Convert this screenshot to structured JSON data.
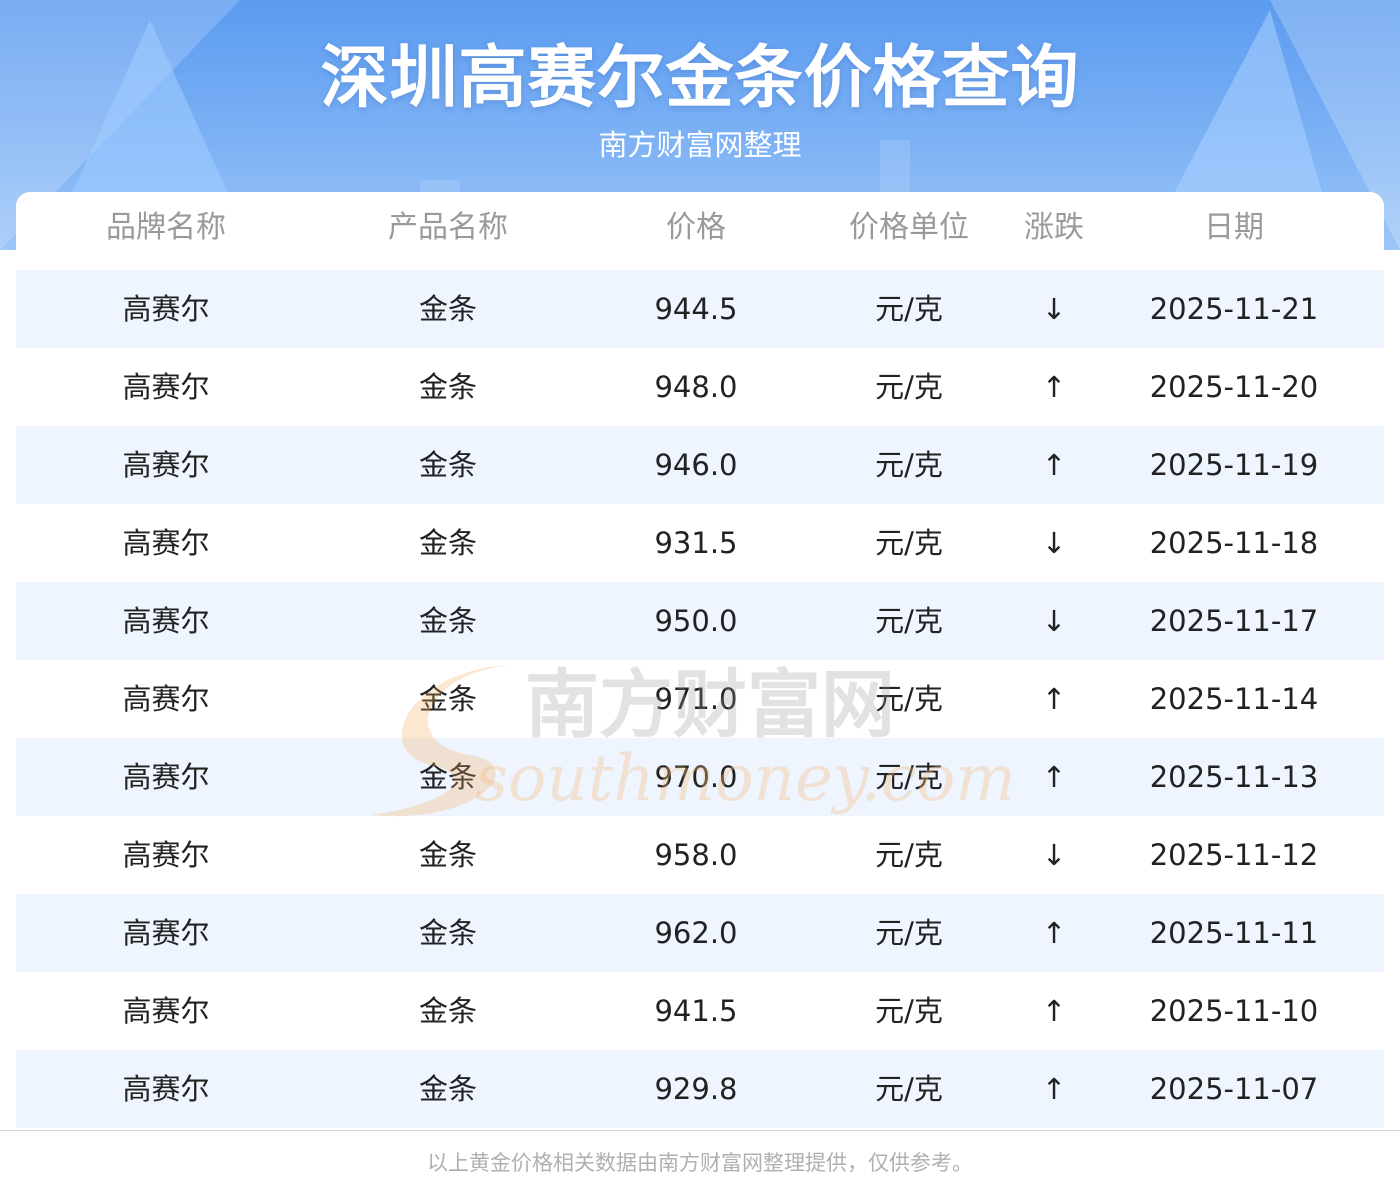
{
  "header": {
    "title": "深圳高赛尔金条价格查询",
    "subtitle": "南方财富网整理"
  },
  "table": {
    "columns": [
      "品牌名称",
      "产品名称",
      "价格",
      "价格单位",
      "涨跌",
      "日期"
    ],
    "rows": [
      {
        "brand": "高赛尔",
        "product": "金条",
        "price": "944.5",
        "unit": "元/克",
        "trend": "↓",
        "trend_dir": "down",
        "date": "2025-11-21"
      },
      {
        "brand": "高赛尔",
        "product": "金条",
        "price": "948.0",
        "unit": "元/克",
        "trend": "↑",
        "trend_dir": "up",
        "date": "2025-11-20"
      },
      {
        "brand": "高赛尔",
        "product": "金条",
        "price": "946.0",
        "unit": "元/克",
        "trend": "↑",
        "trend_dir": "up",
        "date": "2025-11-19"
      },
      {
        "brand": "高赛尔",
        "product": "金条",
        "price": "931.5",
        "unit": "元/克",
        "trend": "↓",
        "trend_dir": "down",
        "date": "2025-11-18"
      },
      {
        "brand": "高赛尔",
        "product": "金条",
        "price": "950.0",
        "unit": "元/克",
        "trend": "↓",
        "trend_dir": "down",
        "date": "2025-11-17"
      },
      {
        "brand": "高赛尔",
        "product": "金条",
        "price": "971.0",
        "unit": "元/克",
        "trend": "↑",
        "trend_dir": "up",
        "date": "2025-11-14"
      },
      {
        "brand": "高赛尔",
        "product": "金条",
        "price": "970.0",
        "unit": "元/克",
        "trend": "↑",
        "trend_dir": "up",
        "date": "2025-11-13"
      },
      {
        "brand": "高赛尔",
        "product": "金条",
        "price": "958.0",
        "unit": "元/克",
        "trend": "↓",
        "trend_dir": "down",
        "date": "2025-11-12"
      },
      {
        "brand": "高赛尔",
        "product": "金条",
        "price": "962.0",
        "unit": "元/克",
        "trend": "↑",
        "trend_dir": "up",
        "date": "2025-11-11"
      },
      {
        "brand": "高赛尔",
        "product": "金条",
        "price": "941.5",
        "unit": "元/克",
        "trend": "↑",
        "trend_dir": "up",
        "date": "2025-11-10"
      },
      {
        "brand": "高赛尔",
        "product": "金条",
        "price": "929.8",
        "unit": "元/克",
        "trend": "↑",
        "trend_dir": "up",
        "date": "2025-11-07"
      }
    ]
  },
  "watermark": {
    "cn": "南方财富网",
    "en": "southmoney.com"
  },
  "footer": {
    "note": "以上黄金价格相关数据由南方财富网整理提供，仅供参考。"
  },
  "colors": {
    "up": "#e60000",
    "down": "#1a8a1a",
    "banner": "#5b9bf0",
    "alt_row": "#eef5ff"
  }
}
